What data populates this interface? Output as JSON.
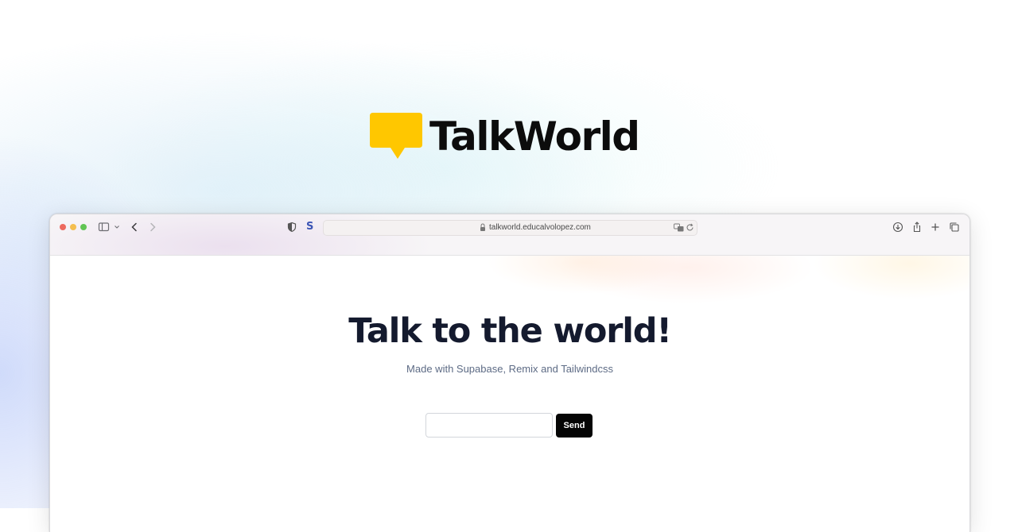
{
  "brand": {
    "name": "TalkWorld",
    "logo_icon": "speech-bubble-icon",
    "logo_color": "#FFC700"
  },
  "browser": {
    "address_url": "talkworld.educalvolopez.com",
    "extension_letter": "S",
    "traffic_light_colors": [
      "#ED6A5E",
      "#F4BE4F",
      "#61C554"
    ]
  },
  "page": {
    "headline": "Talk to the world!",
    "subtitle": "Made with Supabase, Remix and Tailwindcss",
    "message_input": {
      "value": "",
      "placeholder": ""
    },
    "send_label": "Send"
  }
}
